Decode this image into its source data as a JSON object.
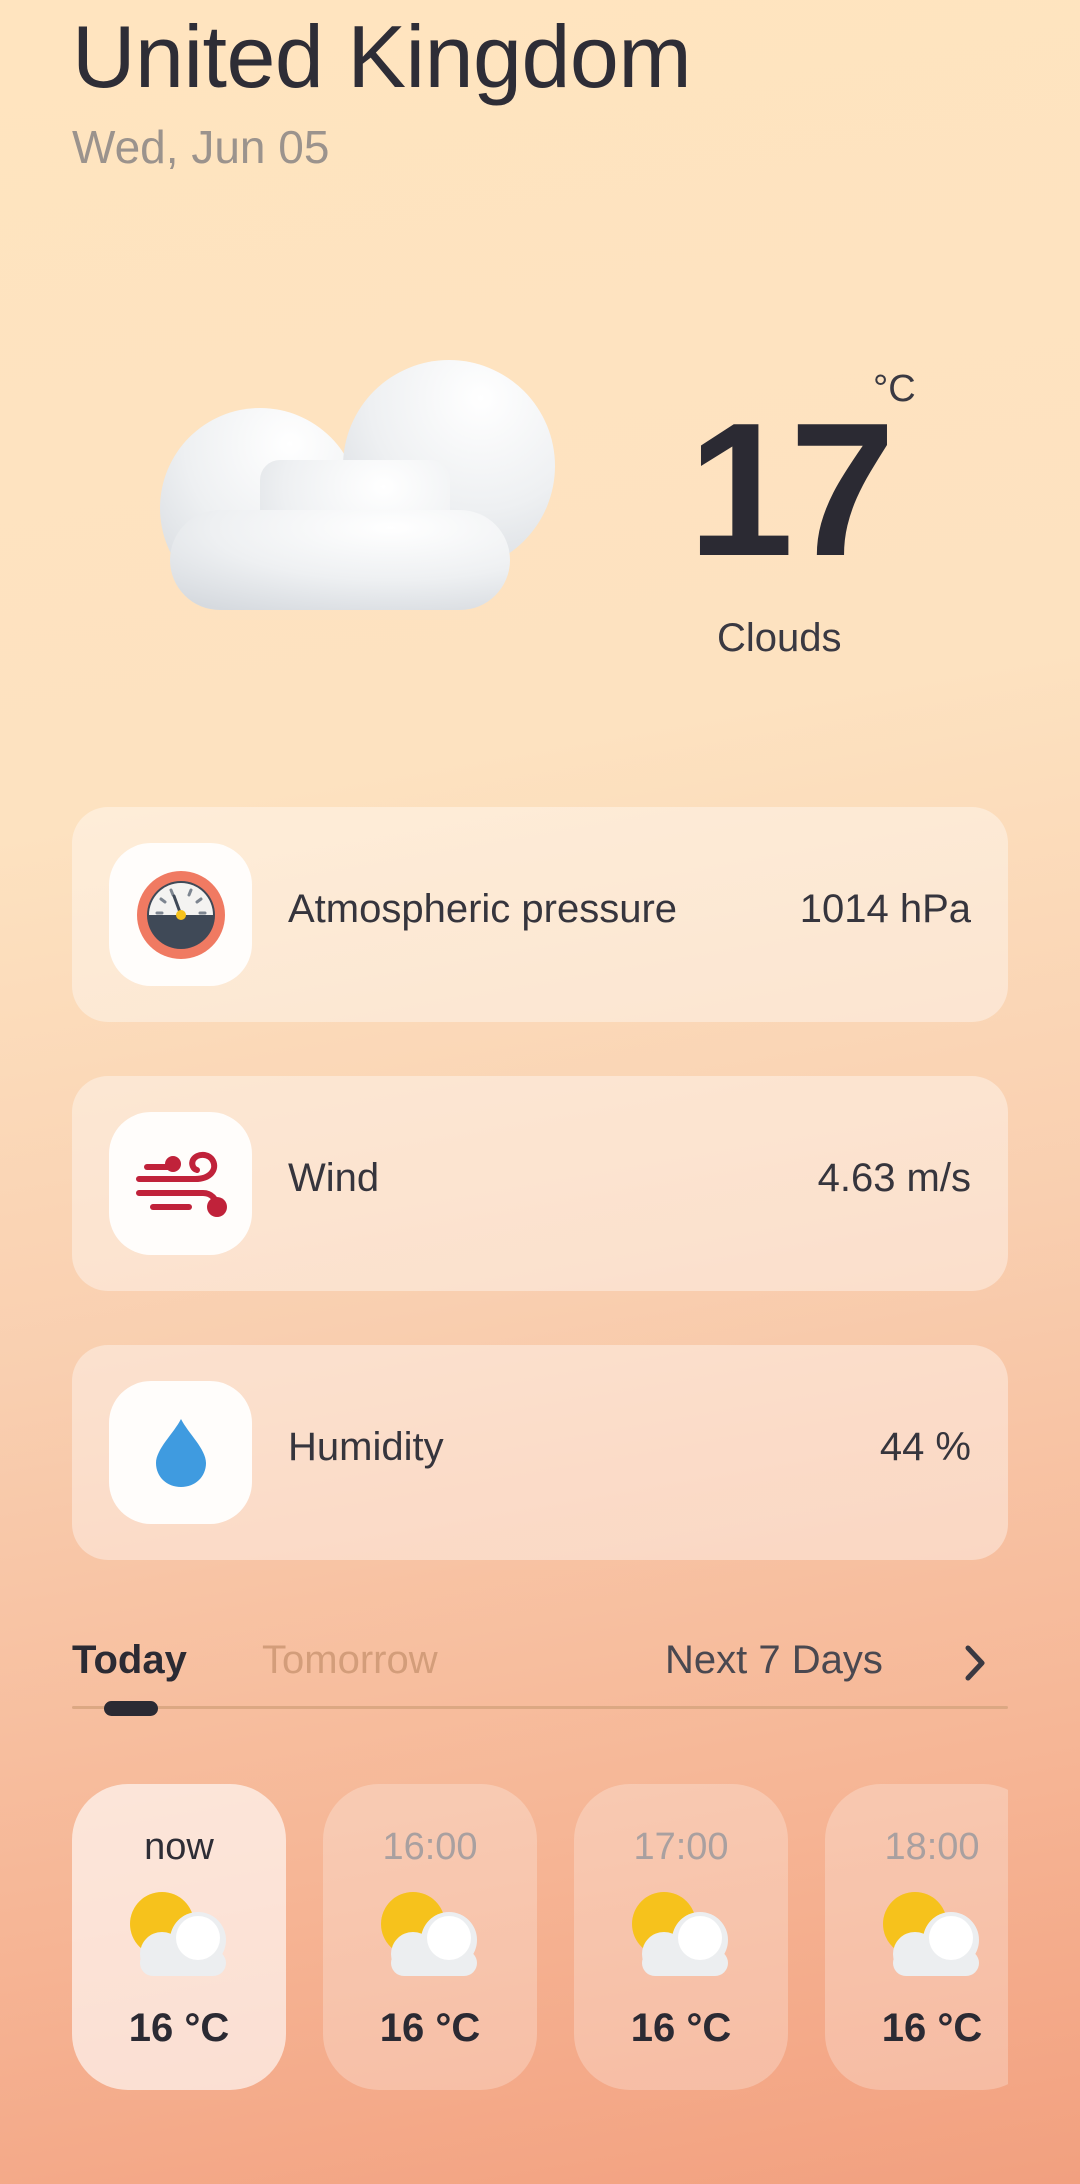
{
  "header": {
    "location": "United Kingdom",
    "date": "Wed, Jun 05"
  },
  "current": {
    "temperature": "17",
    "unit": "°C",
    "condition": "Clouds",
    "icon": "cloud-icon"
  },
  "stats": [
    {
      "label": "Atmospheric pressure",
      "value": "1014 hPa",
      "icon": "pressure-gauge-icon"
    },
    {
      "label": "Wind",
      "value": "4.63 m/s",
      "icon": "wind-icon"
    },
    {
      "label": "Humidity",
      "value": "44 %",
      "icon": "water-drop-icon"
    }
  ],
  "tabs": {
    "today": "Today",
    "tomorrow": "Tomorrow",
    "next_days": "Next 7 Days",
    "selected": "Today"
  },
  "hourly": [
    {
      "time": "now",
      "temp": "16 °C",
      "icon": "partly-cloudy-icon",
      "active": true
    },
    {
      "time": "16:00",
      "temp": "16 °C",
      "icon": "partly-cloudy-icon",
      "active": false
    },
    {
      "time": "17:00",
      "temp": "16 °C",
      "icon": "partly-cloudy-icon",
      "active": false
    },
    {
      "time": "18:00",
      "temp": "16 °C",
      "icon": "partly-cloudy-icon",
      "active": false
    }
  ],
  "colors": {
    "text_primary": "#2b2a33",
    "text_muted": "#9b938d",
    "tab_inactive": "#d39d7a",
    "pressure_ring": "#f07a62",
    "wind": "#c0223a",
    "humidity": "#3f9be0",
    "sun": "#f6c21c"
  }
}
